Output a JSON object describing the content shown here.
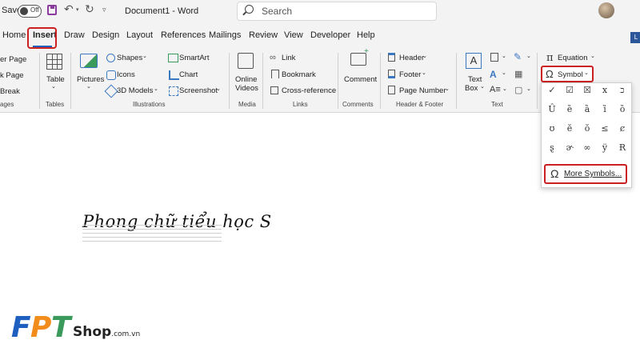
{
  "titlebar": {
    "autosave_label": "Save",
    "toggle_state": "Off",
    "doc_title": "Document1  -  Word",
    "search_placeholder": "Search"
  },
  "tabs": [
    "Home",
    "Insert",
    "Draw",
    "Design",
    "Layout",
    "References",
    "Mailings",
    "Review",
    "View",
    "Developer",
    "Help"
  ],
  "active_tab": "Insert",
  "ribbon": {
    "pages": {
      "items": [
        "er Page",
        "k Page",
        "Break"
      ],
      "group": "ages"
    },
    "tables": {
      "table_label": "Table",
      "group": "Tables"
    },
    "illustrations": {
      "pictures": "Pictures",
      "shapes": "Shapes",
      "icons": "Icons",
      "models": "3D Models",
      "smartart": "SmartArt",
      "chart": "Chart",
      "screenshot": "Screenshot",
      "group": "Illustrations"
    },
    "media": {
      "online": "Online",
      "videos": "Videos",
      "group": "Media"
    },
    "links": {
      "link": "Link",
      "bookmark": "Bookmark",
      "crossref": "Cross-reference",
      "group": "Links"
    },
    "comments": {
      "comment": "Comment",
      "group": "Comments"
    },
    "header_footer": {
      "header": "Header",
      "footer": "Footer",
      "page_number": "Page Number",
      "group": "Header & Footer"
    },
    "text": {
      "textbox_1": "Text",
      "textbox_2": "Box",
      "group": "Text"
    },
    "symbols": {
      "equation": "Equation",
      "symbol": "Symbol"
    }
  },
  "document": {
    "text": "Phong chữ tiểu học S"
  },
  "symbol_panel": {
    "symbols": [
      "✓",
      "☑",
      "☒",
      "x",
      "ﬤ",
      "Ȗ",
      "ȅ",
      "ȁ",
      "ȉ",
      "ȍ",
      "ʊ",
      "ĕ",
      "ŏ",
      "≤",
      "ȼ",
      "ȿ",
      "ɚ",
      "∞",
      "ÿ",
      "Ɍ"
    ],
    "more_symbols": "More Symbols..."
  },
  "logo": {
    "letters": [
      "F",
      "P",
      "T"
    ],
    "shop": "Shop",
    "domain": ".com.vn"
  }
}
